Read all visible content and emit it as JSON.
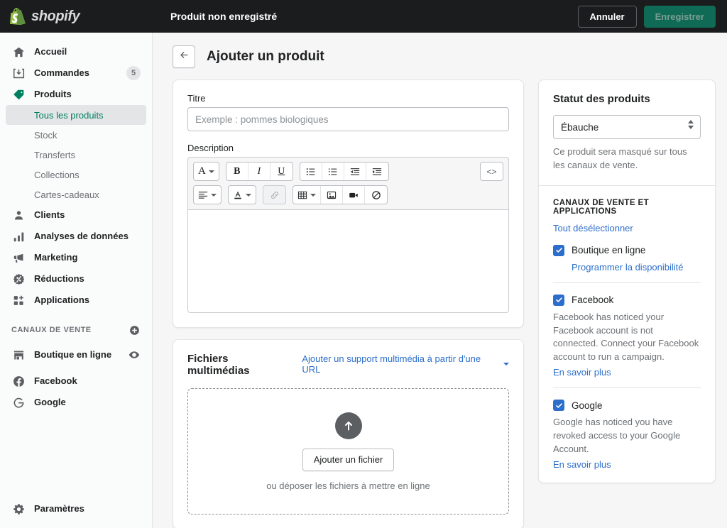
{
  "topbar": {
    "brand": "shopify",
    "title": "Produit non enregistré",
    "cancel_label": "Annuler",
    "save_label": "Enregistrer",
    "bg_color": "#1a1c1d",
    "save_color": "#0f6b55"
  },
  "sidebar": {
    "items": [
      {
        "label": "Accueil",
        "icon": "home-icon",
        "badge": ""
      },
      {
        "label": "Commandes",
        "icon": "orders-icon",
        "badge": "5"
      },
      {
        "label": "Produits",
        "icon": "products-tag-icon",
        "badge": "",
        "active": true
      }
    ],
    "sub_items": [
      {
        "label": "Tous les produits",
        "active": true
      },
      {
        "label": "Stock",
        "active": false
      },
      {
        "label": "Transferts",
        "active": false
      },
      {
        "label": "Collections",
        "active": false
      },
      {
        "label": "Cartes-cadeaux",
        "active": false
      }
    ],
    "items2": [
      {
        "label": "Clients",
        "icon": "customers-icon"
      },
      {
        "label": "Analyses de données",
        "icon": "analytics-icon"
      },
      {
        "label": "Marketing",
        "icon": "marketing-megaphone-icon"
      },
      {
        "label": "Réductions",
        "icon": "discounts-icon"
      },
      {
        "label": "Applications",
        "icon": "apps-icon"
      }
    ],
    "channels_heading": "CANAUX DE VENTE",
    "channels": [
      {
        "label": "Boutique en ligne",
        "icon": "storefront-icon",
        "trailing": "eye-icon"
      },
      {
        "label": "Facebook",
        "icon": "facebook-icon",
        "trailing": ""
      },
      {
        "label": "Google",
        "icon": "google-icon",
        "trailing": ""
      }
    ],
    "settings": {
      "label": "Paramètres",
      "icon": "gear-icon"
    },
    "active_accent": "#008060"
  },
  "page": {
    "title": "Ajouter un produit",
    "back_icon": "arrow-left-icon"
  },
  "product_form": {
    "title_label": "Titre",
    "title_value": "",
    "title_placeholder": "Exemple : pommes biologiques",
    "description_label": "Description",
    "description_value": "",
    "toolbar_row1": [
      {
        "name": "font-style-icon",
        "glyph": "A",
        "caret": true,
        "disabled": false
      },
      {
        "name": "bold-icon",
        "glyph": "B",
        "caret": false,
        "disabled": false
      },
      {
        "name": "italic-icon",
        "glyph": "I",
        "caret": false,
        "disabled": false
      },
      {
        "name": "underline-icon",
        "glyph": "U",
        "caret": false,
        "disabled": false
      },
      {
        "name": "bulleted-list-icon",
        "glyph": "≔",
        "caret": false,
        "disabled": false
      },
      {
        "name": "numbered-list-icon",
        "glyph": "≡",
        "caret": false,
        "disabled": false
      },
      {
        "name": "outdent-icon",
        "glyph": "⇤",
        "caret": false,
        "disabled": false
      },
      {
        "name": "indent-icon",
        "glyph": "⇥",
        "caret": false,
        "disabled": false
      },
      {
        "name": "code-view-icon",
        "glyph": "<>",
        "caret": false,
        "disabled": false
      }
    ],
    "toolbar_row2": [
      {
        "name": "align-icon",
        "glyph": "≣",
        "caret": true,
        "disabled": false
      },
      {
        "name": "text-color-icon",
        "glyph": "A",
        "caret": true,
        "disabled": false
      },
      {
        "name": "link-icon",
        "glyph": "🔗",
        "caret": false,
        "disabled": true
      },
      {
        "name": "table-icon",
        "glyph": "▦",
        "caret": true,
        "disabled": false
      },
      {
        "name": "insert-image-icon",
        "glyph": "🖼",
        "caret": false,
        "disabled": false
      },
      {
        "name": "insert-video-icon",
        "glyph": "🎥",
        "caret": false,
        "disabled": false
      },
      {
        "name": "clear-formatting-icon",
        "glyph": "⊘",
        "caret": false,
        "disabled": false
      }
    ]
  },
  "media": {
    "title": "Fichiers multimédias",
    "url_link": "Ajouter un support multimédia à partir d'une URL",
    "upload_icon": "upload-arrow-icon",
    "add_file_label": "Ajouter un fichier",
    "drop_hint": "ou déposer les fichiers à mettre en ligne"
  },
  "status_panel": {
    "title": "Statut des produits",
    "select_value": "Ébauche",
    "note": "Ce produit sera masqué sur tous les canaux de vente."
  },
  "channels_panel": {
    "kicker": "CANAUX DE VENTE ET APPLICATIONS",
    "deselect_link": "Tout désélectionner",
    "items": [
      {
        "label": "Boutique en ligne",
        "checked": true,
        "sub_link": "Programmer la disponibilité",
        "description": "",
        "more_link": ""
      },
      {
        "label": "Facebook",
        "checked": true,
        "sub_link": "",
        "description": "Facebook has noticed your Facebook account is not connected. Connect your Facebook account to run a campaign.",
        "more_link": "En savoir plus"
      },
      {
        "label": "Google",
        "checked": true,
        "sub_link": "",
        "description": "Google has noticed you have revoked access to your Google Account.",
        "more_link": "En savoir plus"
      }
    ],
    "checkbox_color": "#2c6ecb",
    "link_color": "#2c6ecb"
  }
}
